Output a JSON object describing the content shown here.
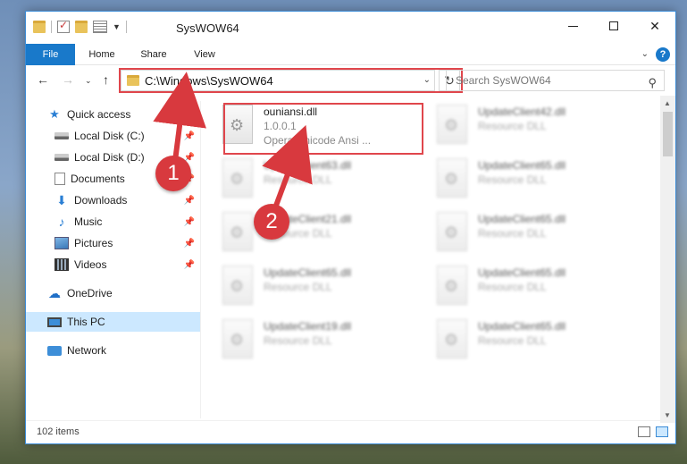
{
  "window": {
    "title": "SysWOW64"
  },
  "ribbon": {
    "tabs": [
      "File",
      "Home",
      "Share",
      "View"
    ],
    "help": "?"
  },
  "nav": {
    "address": "C:\\Windows\\SysWOW64",
    "search_placeholder": "Search SysWOW64"
  },
  "sidebar": {
    "items": [
      {
        "label": "Quick access",
        "icon": "star-icon"
      },
      {
        "label": "Local Disk (C:)",
        "icon": "drive-icon",
        "pinned": true
      },
      {
        "label": "Local Disk (D:)",
        "icon": "drive-icon",
        "pinned": true
      },
      {
        "label": "Documents",
        "icon": "documents-icon",
        "pinned": true
      },
      {
        "label": "Downloads",
        "icon": "download-icon",
        "pinned": true
      },
      {
        "label": "Music",
        "icon": "music-icon",
        "pinned": true
      },
      {
        "label": "Pictures",
        "icon": "pictures-icon",
        "pinned": true
      },
      {
        "label": "Videos",
        "icon": "videos-icon",
        "pinned": true
      },
      {
        "label": "OneDrive",
        "icon": "onedrive-icon"
      },
      {
        "label": "This PC",
        "icon": "computer-icon",
        "selected": true
      },
      {
        "label": "Network",
        "icon": "network-icon"
      }
    ]
  },
  "files": [
    {
      "name": "ouniansi.dll",
      "version": "1.0.0.1",
      "desc": "Opera Unicode Ansi ..."
    },
    {
      "name": "UpdateClient42.dll",
      "desc": "Resource DLL"
    },
    {
      "name": "UpdateClient63.dll",
      "desc": "Resource DLL"
    },
    {
      "name": "UpdateClient65.dll",
      "desc": "Resource DLL"
    },
    {
      "name": "UpdateClient21.dll",
      "desc": "Resource DLL"
    },
    {
      "name": "UpdateClient65.dll",
      "desc": "Resource DLL"
    },
    {
      "name": "UpdateClient65.dll",
      "desc": "Resource DLL"
    },
    {
      "name": "UpdateClient65.dll",
      "desc": "Resource DLL"
    },
    {
      "name": "UpdateClient19.dll",
      "desc": "Resource DLL"
    },
    {
      "name": "UpdateClient65.dll",
      "desc": "Resource DLL"
    }
  ],
  "status": {
    "items": "102 items"
  },
  "callouts": [
    "1",
    "2"
  ],
  "colors": {
    "accent": "#1979ca",
    "highlight": "#e0464c",
    "callout": "#d8393e",
    "selected": "#cce8ff"
  }
}
